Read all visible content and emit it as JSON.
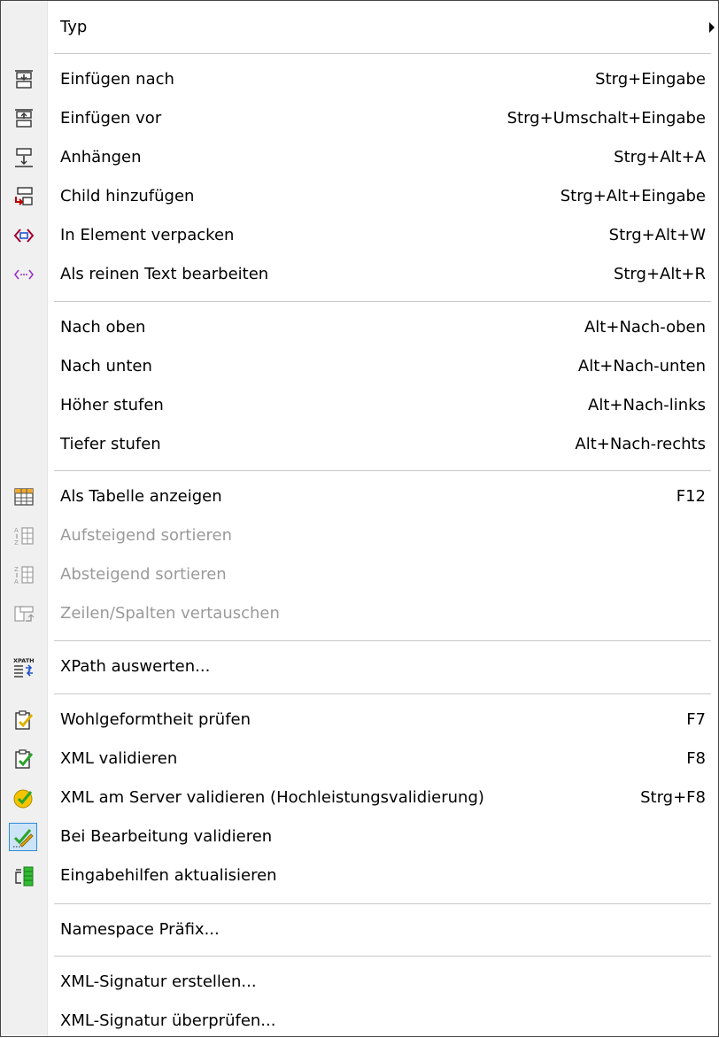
{
  "menu": {
    "items": [
      {
        "label": "Typ",
        "shortcut": "",
        "icon": "",
        "submenu": true
      },
      {
        "label": "Einfügen nach",
        "shortcut": "Strg+Eingabe",
        "icon": "insert-after-icon"
      },
      {
        "label": "Einfügen vor",
        "shortcut": "Strg+Umschalt+Eingabe",
        "icon": "insert-before-icon"
      },
      {
        "label": "Anhängen",
        "shortcut": "Strg+Alt+A",
        "icon": "append-icon"
      },
      {
        "label": "Child hinzufügen",
        "shortcut": "Strg+Alt+Eingabe",
        "icon": "add-child-icon"
      },
      {
        "label": "In Element verpacken",
        "shortcut": "Strg+Alt+W",
        "icon": "wrap-element-icon"
      },
      {
        "label": "Als reinen Text bearbeiten",
        "shortcut": "Strg+Alt+R",
        "icon": "plain-text-icon"
      },
      {
        "label": "Nach oben",
        "shortcut": "Alt+Nach-oben",
        "icon": ""
      },
      {
        "label": "Nach unten",
        "shortcut": "Alt+Nach-unten",
        "icon": ""
      },
      {
        "label": "Höher stufen",
        "shortcut": "Alt+Nach-links",
        "icon": ""
      },
      {
        "label": "Tiefer stufen",
        "shortcut": "Alt+Nach-rechts",
        "icon": ""
      },
      {
        "label": "Als Tabelle anzeigen",
        "shortcut": "F12",
        "icon": "table-icon"
      },
      {
        "label": "Aufsteigend sortieren",
        "shortcut": "",
        "icon": "sort-ascending-icon",
        "disabled": true
      },
      {
        "label": "Absteigend sortieren",
        "shortcut": "",
        "icon": "sort-descending-icon",
        "disabled": true
      },
      {
        "label": "Zeilen/Spalten vertauschen",
        "shortcut": "",
        "icon": "swap-rows-columns-icon",
        "disabled": true
      },
      {
        "label": "XPath auswerten...",
        "shortcut": "",
        "icon": "xpath-icon"
      },
      {
        "label": "Wohlgeformtheit prüfen",
        "shortcut": "F7",
        "icon": "well-formed-check-icon"
      },
      {
        "label": "XML validieren",
        "shortcut": "F8",
        "icon": "validate-icon"
      },
      {
        "label": "XML am Server validieren (Hochleistungsvalidierung)",
        "shortcut": "Strg+F8",
        "icon": "server-validate-icon"
      },
      {
        "label": "Bei Bearbeitung validieren",
        "shortcut": "",
        "icon": "validate-on-edit-icon",
        "checked": true
      },
      {
        "label": "Eingabehilfen aktualisieren",
        "shortcut": "",
        "icon": "refresh-entry-helpers-icon"
      },
      {
        "label": "Namespace Präfix...",
        "shortcut": "",
        "icon": ""
      },
      {
        "label": "XML-Signatur erstellen...",
        "shortcut": "",
        "icon": ""
      },
      {
        "label": "XML-Signatur überprüfen...",
        "shortcut": "",
        "icon": ""
      }
    ]
  },
  "colors": {
    "gutter": "#f0f0f0",
    "disabled_text": "#9a9a9a",
    "check_highlight": "#cce4f7",
    "accent": "#2f8ad8"
  }
}
